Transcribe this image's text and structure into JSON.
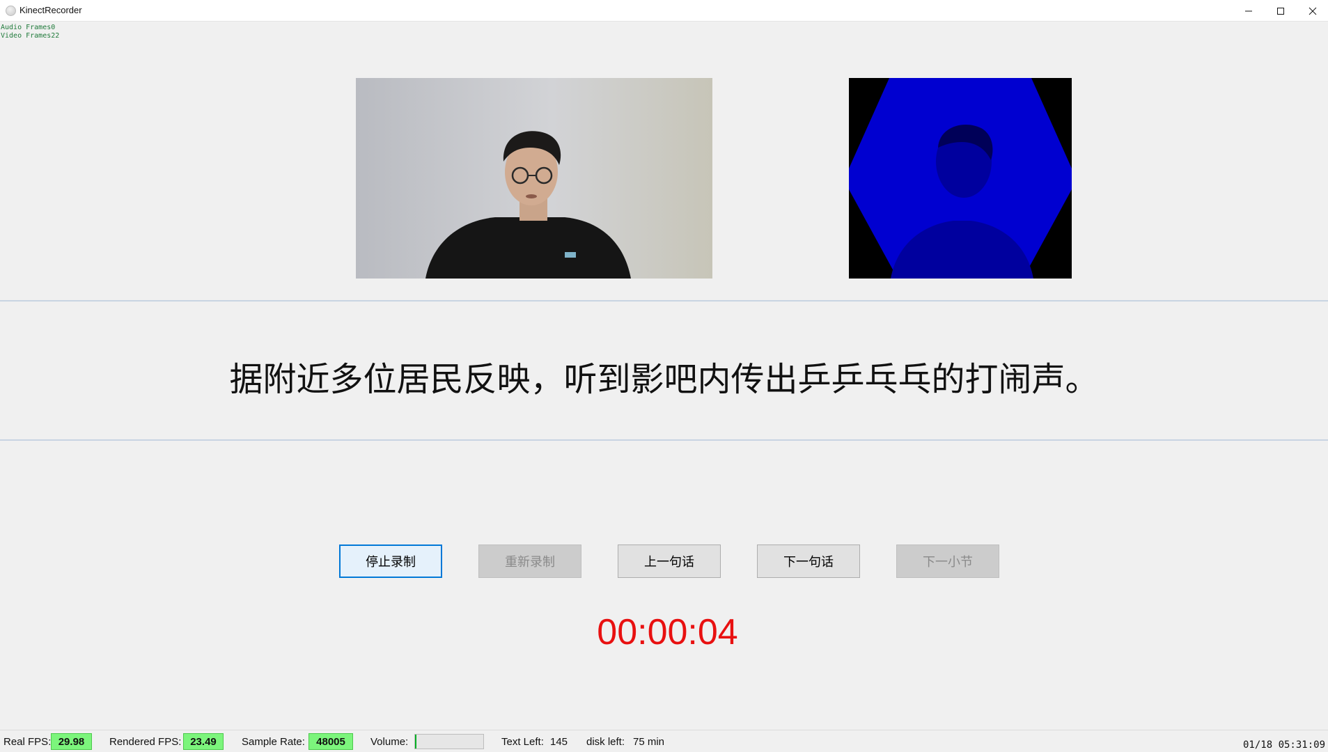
{
  "window": {
    "title": "KinectRecorder"
  },
  "debug": {
    "audio_label": "Audio Frames",
    "audio_value": "0",
    "video_label": "Video Frames",
    "video_value": "22"
  },
  "prompt": {
    "sentence": "据附近多位居民反映，听到影吧内传出乒乒乓乓的打闹声。"
  },
  "controls": {
    "stop_label": "停止录制",
    "rerecord_label": "重新录制",
    "prev_label": "上一句话",
    "next_label": "下一句话",
    "next_section_label": "下一小节"
  },
  "timer": {
    "elapsed": "00:00:04"
  },
  "status": {
    "real_fps_label": "Real FPS:",
    "real_fps_value": "29.98",
    "rendered_fps_label": "Rendered FPS:",
    "rendered_fps_value": "23.49",
    "sample_rate_label": "Sample Rate:",
    "sample_rate_value": "48005",
    "volume_label": "Volume:",
    "volume_level": 0.02,
    "text_left_label": "Text Left:",
    "text_left_value": "145",
    "disk_left_label": "disk left:",
    "disk_left_value": "75 min",
    "datetime": "01/18 05:31:09"
  },
  "colors": {
    "timer": "#e81010",
    "status_good": "#7cf57c",
    "depth_fill": "#0000d0",
    "primary_border": "#0078d7"
  }
}
